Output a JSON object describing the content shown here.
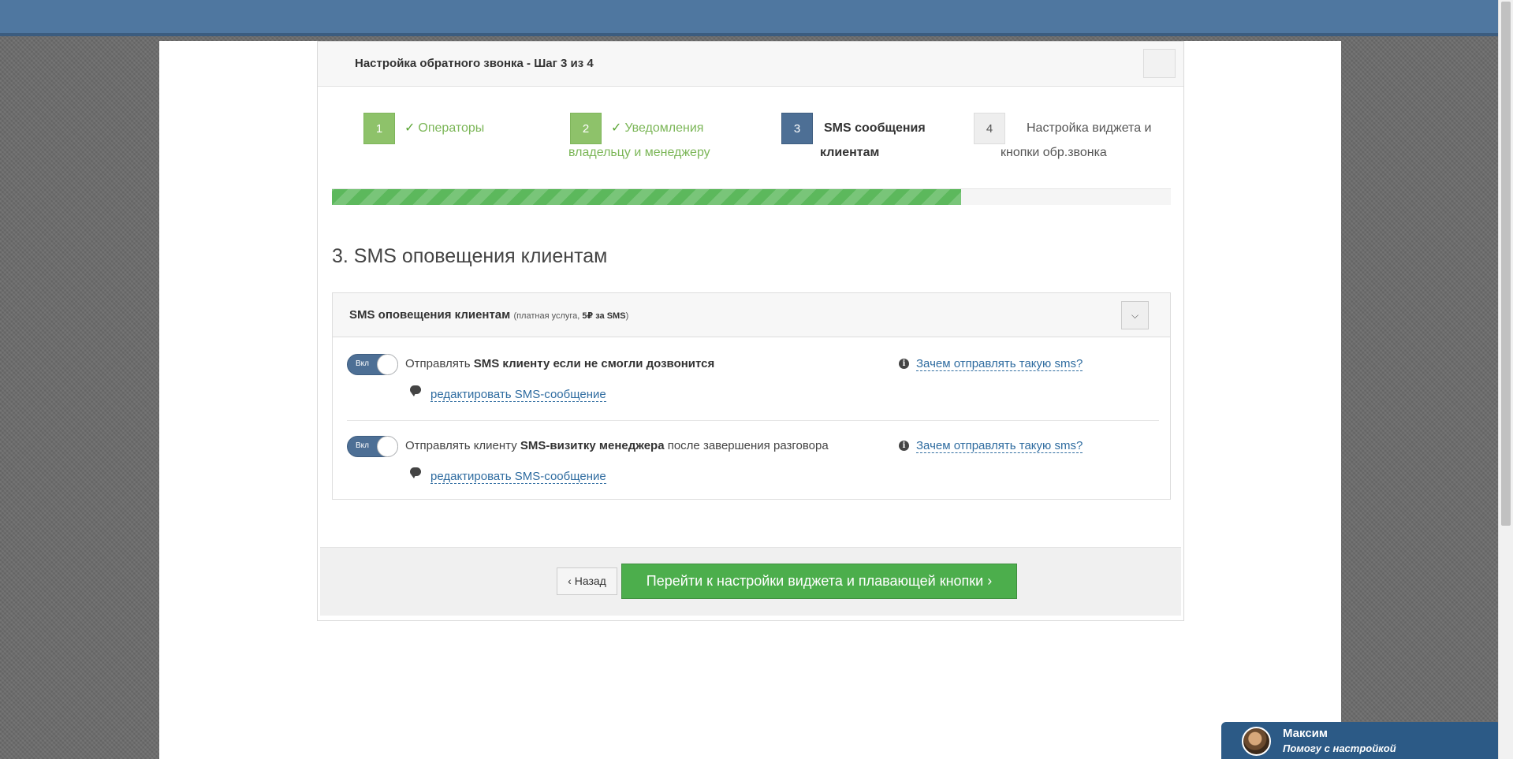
{
  "modal": {
    "title": "Настройка обратного звонка - Шаг 3 из 4"
  },
  "steps": [
    {
      "num": "1",
      "label": "Операторы",
      "status": "done"
    },
    {
      "num": "2",
      "label": "Уведомления владельцу и менеджеру",
      "line1": "Уведомления",
      "line2": "владельцу и менеджеру",
      "status": "done"
    },
    {
      "num": "3",
      "label": "SMS сообщения клиентам",
      "line1": "SMS сообщения",
      "line2": "клиентам",
      "status": "active"
    },
    {
      "num": "4",
      "label": "Настройка виджета и кнопки обр.звонка",
      "line1": "Настройка виджета и",
      "line2": "кнопки обр.звонка",
      "status": "pending"
    }
  ],
  "progress": {
    "fraction": 0.75
  },
  "section": {
    "title": "3. SMS оповещения клиентам"
  },
  "panel": {
    "title": "SMS оповещения клиентам",
    "note_prefix": "(платная услуга, ",
    "note_price": "5₽ за SMS",
    "note_suffix": ")",
    "rows": [
      {
        "toggle_label": "Вкл",
        "text_pre": "Отправлять ",
        "text_bold": "SMS клиенту если не смогли дозвонится",
        "text_post": "",
        "edit_link": "редактировать SMS-сообщение",
        "info_link": "Зачем отправлять такую sms?"
      },
      {
        "toggle_label": "Вкл",
        "text_pre": "Отправлять клиенту ",
        "text_bold": "SMS-визитку менеджера",
        "text_post": " после завершения разговора",
        "edit_link": "редактировать SMS-сообщение",
        "info_link": "Зачем отправлять такую sms?"
      }
    ]
  },
  "footer": {
    "back_label": "‹ Назад",
    "next_label": "Перейти к настройки виджета и плавающей кнопки ›"
  },
  "chat": {
    "name": "Максим",
    "subtitle": "Помогу с настройкой"
  },
  "colors": {
    "topbar": "#4f77a0",
    "step_done": "#8ec26a",
    "step_active": "#4d6f95",
    "progress": "#5cb85c",
    "primary_button": "#4cae4c",
    "link": "#2f6ca0"
  }
}
